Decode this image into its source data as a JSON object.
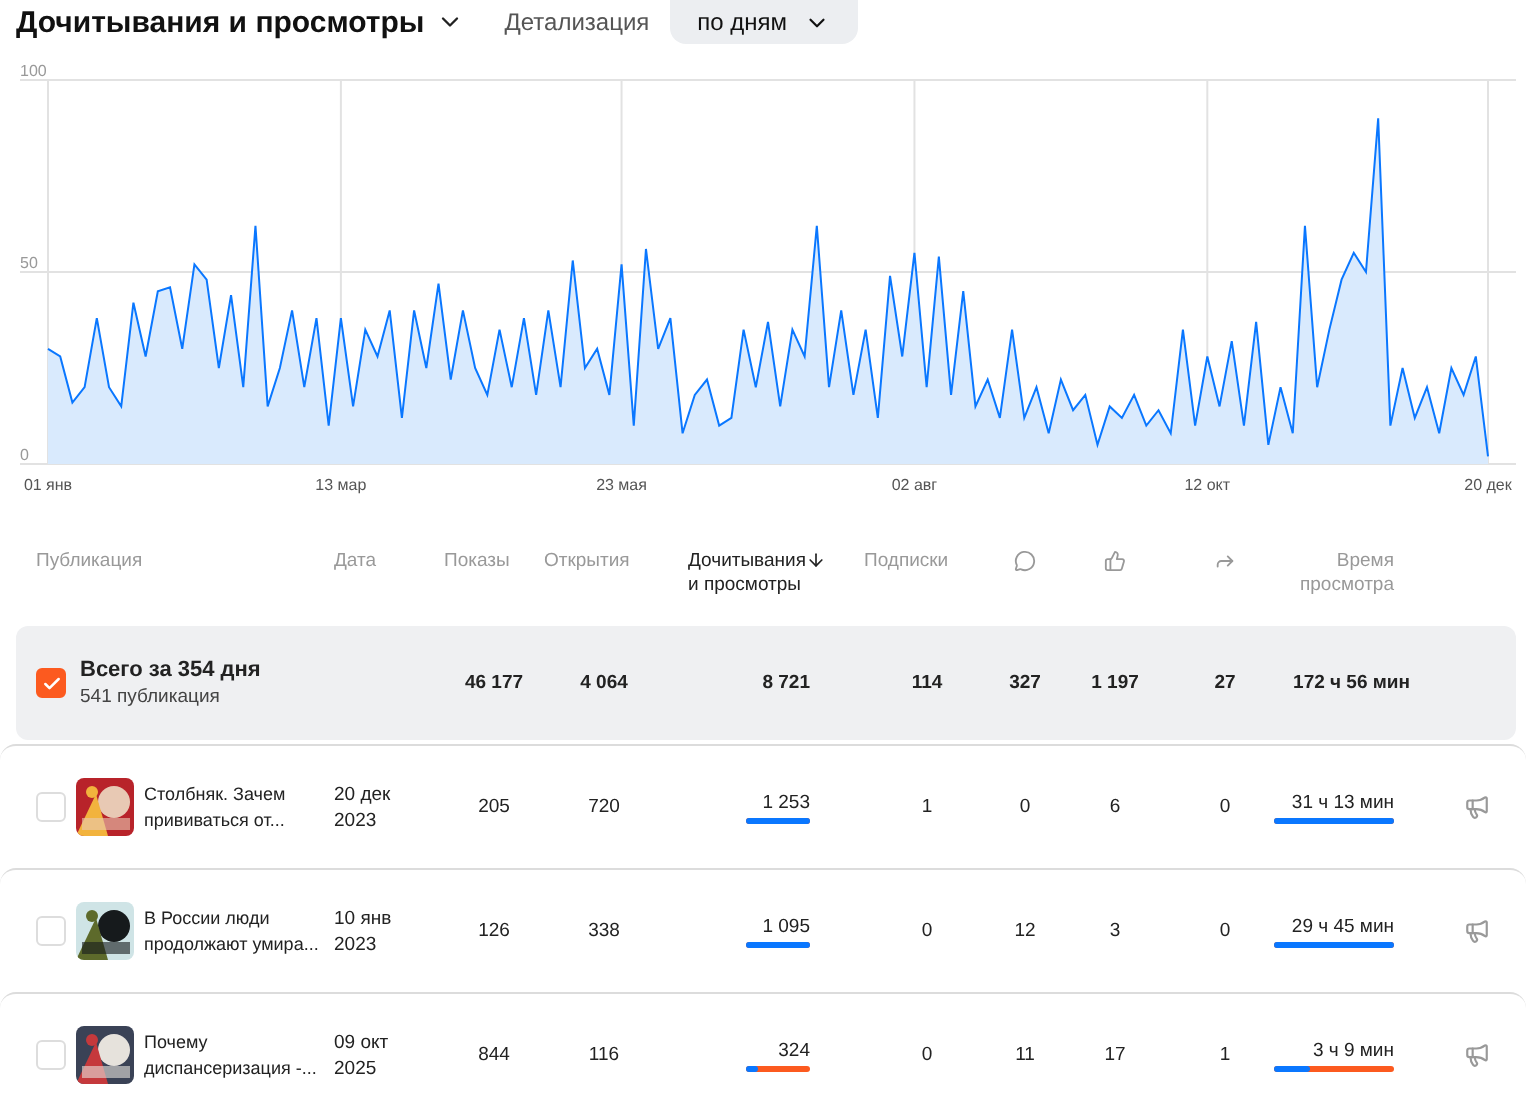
{
  "header": {
    "title": "Дочитывания и просмотры",
    "detail_label": "Детализация",
    "detail_value": "по дням"
  },
  "chart": {
    "chart_data": {
      "type": "area",
      "grid": true,
      "ylim": [
        0,
        100
      ],
      "yticks": [
        0,
        50,
        100
      ],
      "categories": [
        "01 янв",
        null,
        null,
        null,
        null,
        null,
        null,
        null,
        null,
        null,
        null,
        null,
        null,
        null,
        null,
        null,
        null,
        null,
        null,
        null,
        null,
        null,
        null,
        null,
        "13 мар",
        null,
        null,
        null,
        null,
        null,
        null,
        null,
        null,
        null,
        null,
        null,
        null,
        null,
        null,
        null,
        null,
        null,
        null,
        null,
        null,
        null,
        null,
        "23 мая",
        null,
        null,
        null,
        null,
        null,
        null,
        null,
        null,
        null,
        null,
        null,
        null,
        null,
        null,
        null,
        null,
        null,
        null,
        null,
        null,
        null,
        null,
        null,
        "02 авг",
        null,
        null,
        null,
        null,
        null,
        null,
        null,
        null,
        null,
        null,
        null,
        null,
        null,
        null,
        null,
        null,
        null,
        null,
        null,
        null,
        null,
        null,
        null,
        "12 окт",
        null,
        null,
        null,
        null,
        null,
        null,
        null,
        null,
        null,
        null,
        null,
        null,
        null,
        null,
        null,
        null,
        null,
        null,
        null,
        null,
        null,
        null,
        "20 дек"
      ],
      "series": [
        {
          "color": "#0a77ff",
          "values": [
            30,
            28,
            16,
            20,
            38,
            20,
            15,
            42,
            28,
            45,
            46,
            30,
            52,
            48,
            25,
            44,
            20,
            62,
            15,
            25,
            40,
            20,
            38,
            10,
            38,
            15,
            35,
            28,
            40,
            12,
            40,
            25,
            47,
            22,
            40,
            25,
            18,
            35,
            20,
            38,
            18,
            40,
            20,
            53,
            25,
            30,
            18,
            52,
            10,
            56,
            30,
            38,
            8,
            18,
            22,
            10,
            12,
            35,
            20,
            37,
            15,
            35,
            28,
            62,
            20,
            40,
            18,
            35,
            12,
            49,
            28,
            55,
            20,
            54,
            18,
            45,
            15,
            22,
            12,
            35,
            12,
            20,
            8,
            22,
            14,
            18,
            5,
            15,
            12,
            18,
            10,
            14,
            8,
            35,
            10,
            28,
            15,
            32,
            10,
            37,
            5,
            20,
            8,
            62,
            20,
            35,
            48,
            55,
            50,
            90,
            10,
            25,
            12,
            20,
            8,
            25,
            18,
            28,
            2
          ]
        }
      ]
    }
  },
  "table": {
    "columns": [
      {
        "kind": "text",
        "label": "Публикация",
        "selected": false
      },
      {
        "kind": "text",
        "label": "Дата",
        "selected": false
      },
      {
        "kind": "text",
        "label": "Показы",
        "selected": false
      },
      {
        "kind": "text",
        "label": "Открытия",
        "selected": false
      },
      {
        "kind": "text",
        "label": "Дочитывания\nи просмотры",
        "selected": true
      },
      {
        "kind": "text",
        "label": "Подписки",
        "selected": false
      },
      {
        "kind": "icon",
        "selected": false
      },
      {
        "kind": "icon",
        "selected": false
      },
      {
        "kind": "icon",
        "selected": false
      },
      {
        "kind": "text",
        "label": "Время\nпросмотра",
        "selected": false
      }
    ],
    "total": {
      "checked": true,
      "title": "Всего за 354 дня",
      "subtitle": "541 публикация",
      "shows": "46 177",
      "opens": "4 064",
      "reads": "8 721",
      "subs": "114",
      "comments": "327",
      "likes": "1 197",
      "shares": "27",
      "time": "172 ч 56 мин"
    },
    "rows": [
      {
        "checked": false,
        "title": "Столбняк. Зачем прививаться от...",
        "date": "20 дек 2023",
        "shows": "205",
        "opens": "720",
        "reads": "1 253",
        "reads_bar": {
          "level": 1
        },
        "subs": "1",
        "comments": "0",
        "likes": "6",
        "shares": "0",
        "time": "31 ч 13 мин",
        "time_bar": {
          "level": 1
        }
      },
      {
        "checked": false,
        "title": "В России люди продолжают умира...",
        "date": "10 янв 2023",
        "shows": "126",
        "opens": "338",
        "reads": "1 095",
        "reads_bar": {
          "level": 1
        },
        "subs": "0",
        "comments": "12",
        "likes": "3",
        "shares": "0",
        "time": "29 ч 45 мин",
        "time_bar": {
          "level": 1
        }
      },
      {
        "checked": false,
        "title": "Почему диспансеризация -...",
        "date": "09 окт 2025",
        "shows": "844",
        "opens": "116",
        "reads": "324",
        "reads_bar": {
          "level": 0.2
        },
        "subs": "0",
        "comments": "11",
        "likes": "17",
        "shares": "1",
        "time": "3 ч 9 мин",
        "time_bar": {
          "level": 0.3
        }
      }
    ]
  }
}
